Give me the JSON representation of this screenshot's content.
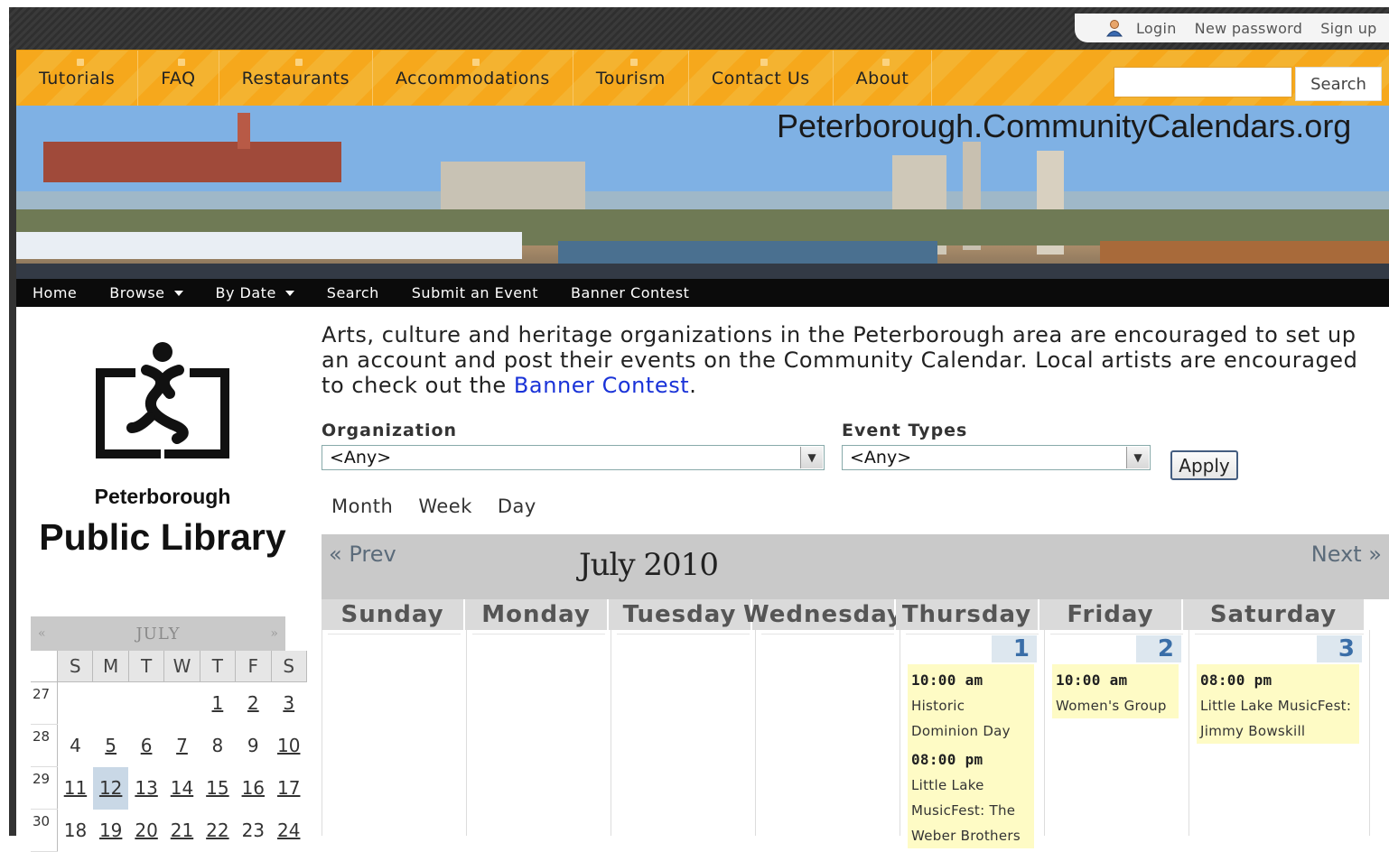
{
  "user_bar": {
    "login": "Login",
    "new_password": "New password",
    "sign_up": "Sign up"
  },
  "main_nav": {
    "items": [
      "Tutorials",
      "FAQ",
      "Restaurants",
      "Accommodations",
      "Tourism",
      "Contact Us",
      "About"
    ],
    "search_button": "Search",
    "search_value": ""
  },
  "banner": {
    "site_title": "Peterborough.CommunityCalendars.org"
  },
  "sub_nav": {
    "home": "Home",
    "browse": "Browse",
    "by_date": "By Date",
    "search": "Search",
    "submit": "Submit an Event",
    "banner_contest": "Banner Contest"
  },
  "sidebar": {
    "logo_city": "Peterborough",
    "logo_library": "Public Library",
    "mini_calendar": {
      "prev": "«",
      "next": "»",
      "title": "JULY",
      "weekdays": [
        "S",
        "M",
        "T",
        "W",
        "T",
        "F",
        "S"
      ],
      "weeks": [
        {
          "wk": "27",
          "days": [
            "",
            "",
            "",
            "",
            "1",
            "2",
            "3"
          ]
        },
        {
          "wk": "28",
          "days": [
            "4",
            "5",
            "6",
            "7",
            "8",
            "9",
            "10"
          ]
        },
        {
          "wk": "29",
          "days": [
            "11",
            "12",
            "13",
            "14",
            "15",
            "16",
            "17"
          ]
        },
        {
          "wk": "30",
          "days": [
            "18",
            "19",
            "20",
            "21",
            "22",
            "23",
            "24"
          ]
        }
      ]
    }
  },
  "intro": {
    "text_before": "Arts, culture and heritage organizations in the Peterborough area are encouraged to set up an account and post their events on the Community Calendar. Local artists are encouraged to check out the ",
    "link_text": "Banner Contest",
    "text_after": "."
  },
  "filters": {
    "organization_label": "Organization",
    "organization_value": "<Any>",
    "event_types_label": "Event Types",
    "event_types_value": "<Any>",
    "apply_label": "Apply"
  },
  "view_tabs": {
    "month": "Month",
    "week": "Week",
    "day": "Day"
  },
  "calendar": {
    "prev": "« Prev",
    "next": "Next »",
    "title": "July 2010",
    "day_headers": [
      "Sunday",
      "Monday",
      "Tuesday",
      "Wednesday",
      "Thursday",
      "Friday",
      "Saturday"
    ],
    "thursday": {
      "day": "1",
      "events": [
        {
          "time": "10:00 am",
          "title_lines": [
            "Historic",
            "Dominion Day"
          ]
        },
        {
          "time": "08:00 pm",
          "title_lines": [
            "Little Lake",
            "MusicFest: The",
            "Weber Brothers"
          ]
        }
      ]
    },
    "friday": {
      "day": "2",
      "events": [
        {
          "time": "10:00 am",
          "title_lines": [
            "Women's Group"
          ]
        }
      ]
    },
    "saturday": {
      "day": "3",
      "events": [
        {
          "time": "08:00 pm",
          "title_lines": [
            "Little Lake MusicFest:",
            "Jimmy Bowskill"
          ]
        }
      ]
    }
  },
  "colors": {
    "nav_orange": "#f6a81c",
    "link_blue": "#1a33d8",
    "event_yellow": "#fefbc5",
    "today_blue": "#c9d8e6"
  }
}
